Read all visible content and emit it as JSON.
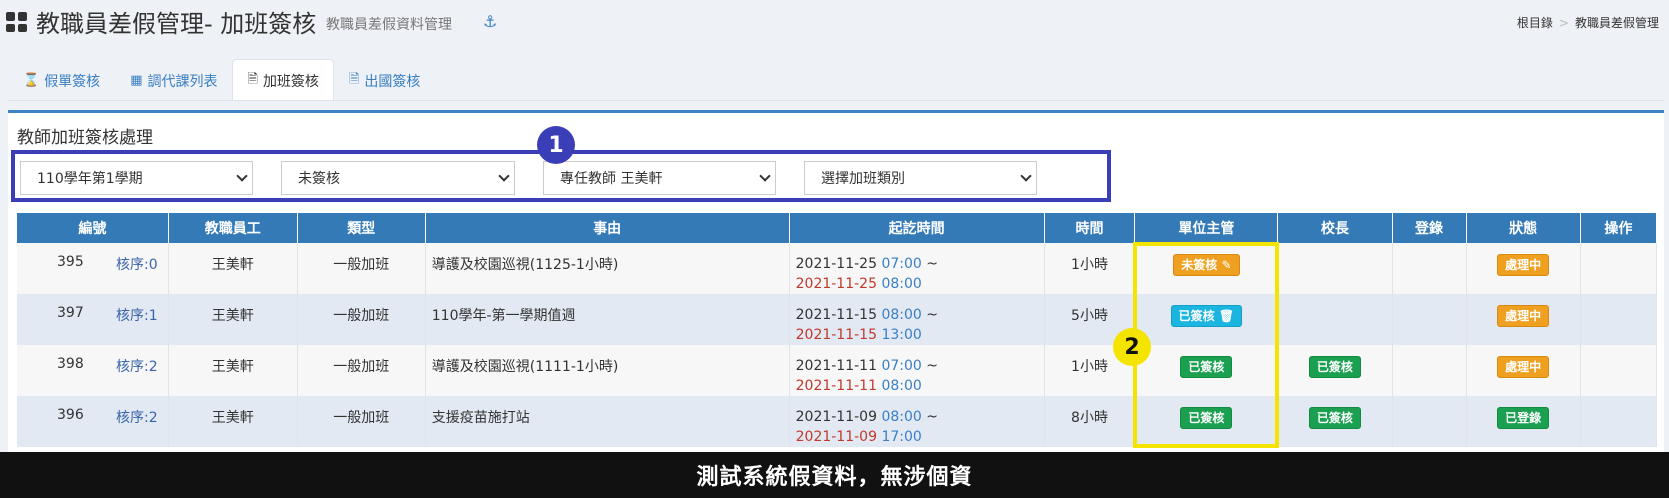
{
  "header": {
    "title": "教職員差假管理- 加班簽核",
    "subtitle": "教職員差假資料管理",
    "breadcrumb": [
      "根目錄",
      "教職員差假管理"
    ]
  },
  "tabs": [
    {
      "label": "假單簽核",
      "icon": "hourglass-icon",
      "active": false
    },
    {
      "label": "調代課列表",
      "icon": "table-icon",
      "active": false
    },
    {
      "label": "加班簽核",
      "icon": "document-icon",
      "active": true
    },
    {
      "label": "出國簽核",
      "icon": "document-icon",
      "active": false
    }
  ],
  "panel": {
    "title": "教師加班簽核處理"
  },
  "filters": {
    "semester": "110學年第1學期",
    "status": "未簽核",
    "teacher": "專任教師 王美軒",
    "category": "選擇加班類別"
  },
  "annotations": {
    "one": "1",
    "two": "2"
  },
  "table": {
    "headers": [
      "編號",
      "教職員工",
      "類型",
      "事由",
      "起訖時間",
      "時間",
      "單位主管",
      "校長",
      "登錄",
      "狀態",
      "操作"
    ],
    "rows": [
      {
        "id": "395",
        "seq": "核序:0",
        "name": "王美軒",
        "type": "一般加班",
        "reason": "導護及校園巡視(1125-1小時)",
        "start_date": "2021-11-25",
        "start_time": "07:00",
        "end_date": "2021-11-25",
        "end_time": "08:00",
        "duration": "1小時",
        "manager": "未簽核",
        "principal": "",
        "status": "處理中"
      },
      {
        "id": "397",
        "seq": "核序:1",
        "name": "王美軒",
        "type": "一般加班",
        "reason": "110學年-第一學期值週",
        "start_date": "2021-11-15",
        "start_time": "08:00",
        "end_date": "2021-11-15",
        "end_time": "13:00",
        "duration": "5小時",
        "manager": "已簽核",
        "principal": "",
        "status": "處理中"
      },
      {
        "id": "398",
        "seq": "核序:2",
        "name": "王美軒",
        "type": "一般加班",
        "reason": "導護及校園巡視(1111-1小時)",
        "start_date": "2021-11-11",
        "start_time": "07:00",
        "end_date": "2021-11-11",
        "end_time": "08:00",
        "duration": "1小時",
        "manager": "已簽核",
        "principal": "已簽核",
        "status": "處理中"
      },
      {
        "id": "396",
        "seq": "核序:2",
        "name": "王美軒",
        "type": "一般加班",
        "reason": "支援疫苗施打站",
        "start_date": "2021-11-09",
        "start_time": "08:00",
        "end_date": "2021-11-09",
        "end_time": "17:00",
        "duration": "8小時",
        "manager": "已簽核",
        "principal": "已簽核",
        "status": "已登錄"
      }
    ]
  },
  "footer": {
    "text": "測試系統假資料，無涉個資"
  },
  "colors": {
    "accent": "#337ab7",
    "annotation_blue": "#3b3fb7",
    "annotation_yellow": "#f5e400",
    "warning": "#f0a020",
    "info": "#1cb5e0",
    "success": "#1aa050"
  }
}
